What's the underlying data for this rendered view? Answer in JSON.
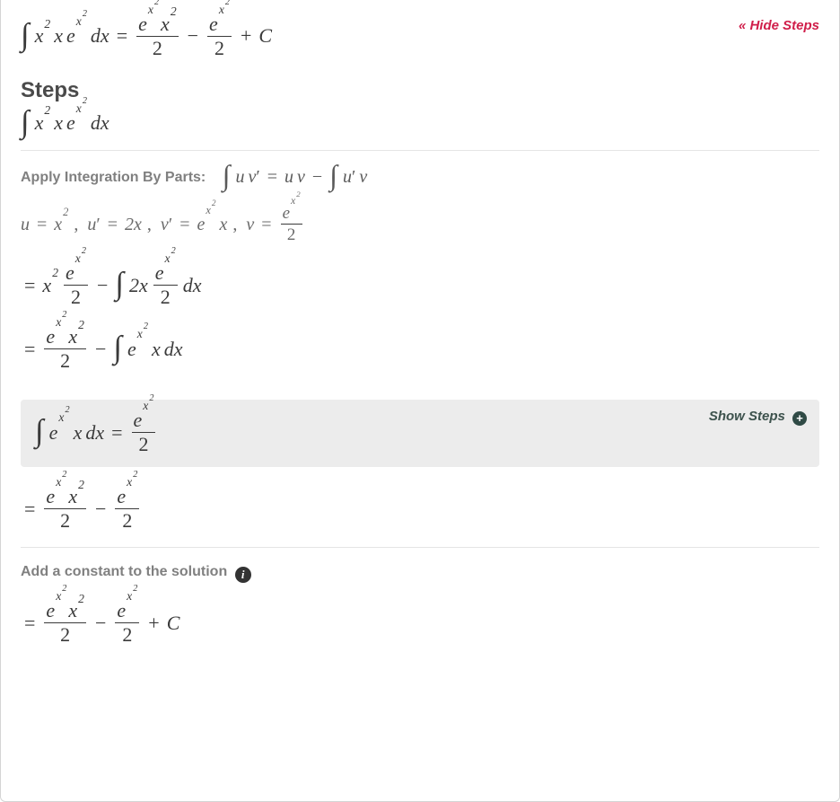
{
  "controls": {
    "hide_steps_label": "« Hide Steps",
    "show_steps_label": "Show Steps",
    "info_tooltip_glyph": "i",
    "plus_glyph": "+"
  },
  "headings": {
    "steps": "Steps"
  },
  "step_labels": {
    "apply_by_parts": "Apply Integration By Parts:",
    "add_constant": "Add a constant to the solution"
  },
  "math": {
    "problem_full": "∫ x^2 · x · e^{x^2} dx = (e^{x^2} x^2)/2 − (e^{x^2})/2 + C",
    "problem": "∫ x^2 · x · e^{x^2} dx",
    "by_parts_rule": "∫ u v' = u v − ∫ u' v",
    "uv_values": "u = x^2,  u' = 2x,  v' = e^{x^2} x,  v = e^{x^2}/2",
    "step_expand_1": "= x^2 · (e^{x^2}/2) − ∫ 2x · (e^{x^2}/2) dx",
    "step_expand_2": "= (e^{x^2} x^2)/2 − ∫ e^{x^2} x dx",
    "sub_integral": "∫ e^{x^2} x dx = e^{x^2}/2",
    "combined": "= (e^{x^2} x^2)/2 − (e^{x^2})/2",
    "final": "= (e^{x^2} x^2)/2 − (e^{x^2})/2 + C"
  },
  "tokens": {
    "x": "x",
    "two": "2",
    "e": "e",
    "d": "d",
    "dx": "dx",
    "eq": "=",
    "minus": "−",
    "plus": "+",
    "C": "C",
    "u": "u",
    "v": "v",
    "comma": ",",
    "2x": "2x"
  }
}
